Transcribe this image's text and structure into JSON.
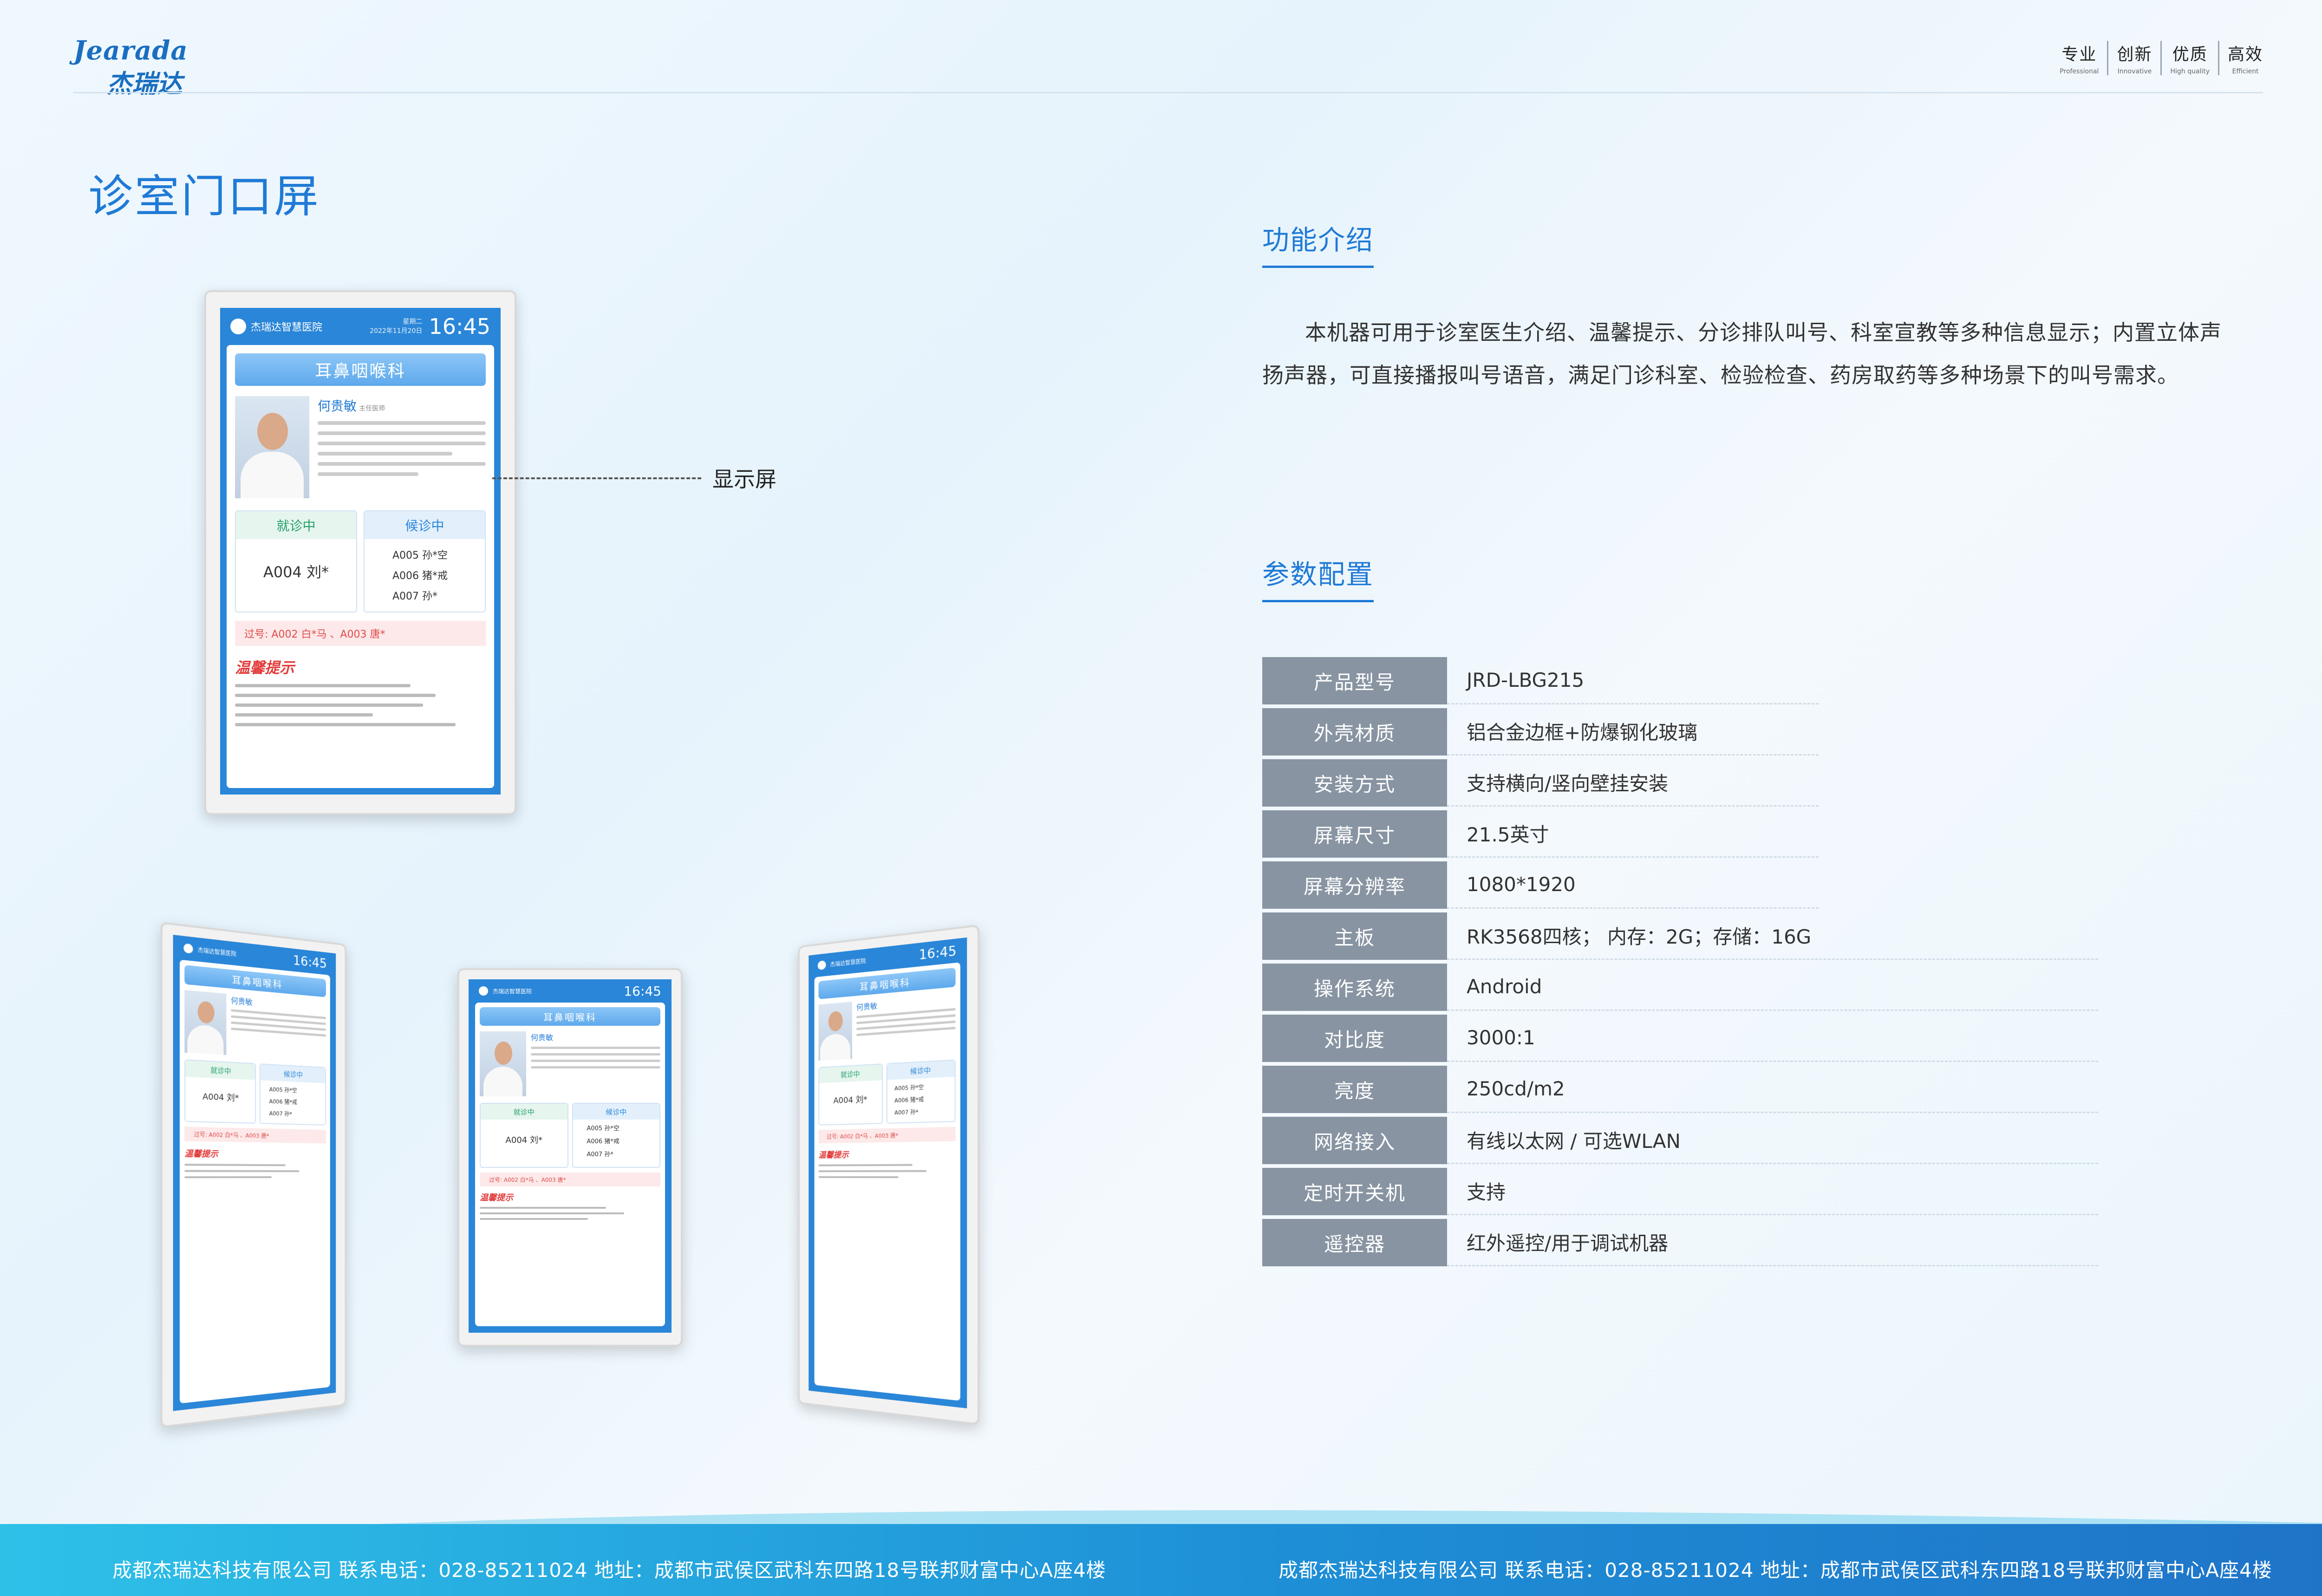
{
  "header": {
    "logo_en": "Jearada",
    "logo_cn": "杰瑞达",
    "slogans": [
      {
        "cn": "专业",
        "en": "Professional"
      },
      {
        "cn": "创新",
        "en": "Innovative"
      },
      {
        "cn": "优质",
        "en": "High quality"
      },
      {
        "cn": "高效",
        "en": "Efficient"
      }
    ]
  },
  "page_title": "诊室门口屏",
  "display_label": "显示屏",
  "intro": {
    "title": "功能介绍",
    "text": "本机器可用于诊室医生介绍、温馨提示、分诊排队叫号、科室宣教等多种信息显示；内置立体声扬声器，可直接播报叫号语音，满足门诊科室、检验检查、药房取药等多种场景下的叫号需求。"
  },
  "specs": {
    "title": "参数配置",
    "rows": [
      {
        "key": "产品型号",
        "value": "JRD-LBG215"
      },
      {
        "key": "外壳材质",
        "value": "铝合金边框+防爆钢化玻璃"
      },
      {
        "key": "安装方式",
        "value": "支持横向/竖向壁挂安装"
      },
      {
        "key": "屏幕尺寸",
        "value": "21.5英寸"
      },
      {
        "key": "屏幕分辨率",
        "value": "1080*1920"
      },
      {
        "key": "主板",
        "value": "RK3568四核； 内存：2G；存储：16G"
      },
      {
        "key": "操作系统",
        "value": "Android"
      },
      {
        "key": "对比度",
        "value": "3000:1"
      },
      {
        "key": "亮度",
        "value": "250cd/m2"
      },
      {
        "key": "网络接入",
        "value": "有线以太网 / 可选WLAN"
      },
      {
        "key": "定时开关机",
        "value": "支持"
      },
      {
        "key": "遥控器",
        "value": "红外遥控/用于调试机器"
      }
    ]
  },
  "screen": {
    "logo": "杰瑞达智慧医院",
    "date": "2022年11月20日",
    "weekday": "星期二",
    "time": "16:45",
    "department": "耳鼻咽喉科",
    "doctor_name": "何贵敏",
    "doctor_title": "主任医师",
    "current_label": "就诊中",
    "current_patient": "A004 刘*",
    "waiting_label": "候诊中",
    "waiting": [
      "A005 孙*空",
      "A006 猪*戒",
      "A007 孙*"
    ],
    "passed": "过号: A002 白*马 、A003 唐*",
    "tips_title": "温馨提示"
  },
  "footer": {
    "left": "成都杰瑞达科技有限公司    联系电话：028-85211024    地址：成都市武侯区武科东四路18号联邦财富中心A座4楼",
    "right": "成都杰瑞达科技有限公司    联系电话：028-85211024    地址：成都市武侯区武科东四路18号联邦财富中心A座4楼"
  },
  "colors": {
    "accent": "#1f7ad6",
    "spec_key_bg": "#8894a2",
    "footer": "#1e8fd6"
  }
}
